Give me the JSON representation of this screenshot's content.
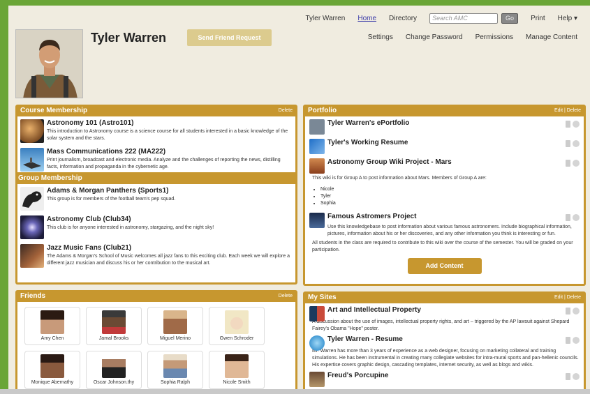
{
  "topnav": {
    "user": "Tyler Warren",
    "home": "Home",
    "directory": "Directory",
    "search_placeholder": "Search AMC",
    "go": "Go",
    "print": "Print",
    "help": "Help ▾"
  },
  "profile": {
    "name": "Tyler Warren",
    "send_friend_request": "Send Friend Request"
  },
  "subnav": {
    "settings": "Settings",
    "change_password": "Change Password",
    "permissions": "Permissions",
    "manage_content": "Manage Content"
  },
  "course_membership": {
    "title": "Course Membership",
    "delete": "Delete",
    "items": [
      {
        "title": "Astronomy 101 (Astro101)",
        "desc": "This introduction to Astronomy course is a science course for all students interested in a basic knowledge of the solar system and the stars."
      },
      {
        "title": "Mass Communications 222 (MA222)",
        "desc": "Print journalism, broadcast and electronic media. Analyze and the challenges of reporting the news, distilling facts, information and propaganda in the cybernetic age."
      }
    ]
  },
  "group_membership": {
    "title": "Group Membership",
    "items": [
      {
        "title": "Adams & Morgan Panthers (Sports1)",
        "desc": "This group is for members of the football team's pep squad."
      },
      {
        "title": "Astronomy Club (Club34)",
        "desc": "This club is for anyone interested in astronomy, stargazing, and the night sky!"
      },
      {
        "title": "Jazz Music Fans (Club21)",
        "desc": "The Adams & Morgan's School of Music welcomes all jazz fans to this exciting club. Each week we will explore a different jazz musician and discuss his or her contribution to the musical art."
      }
    ]
  },
  "friends": {
    "title": "Friends",
    "delete": "Delete",
    "people": [
      "Amy Chen",
      "Jamal Brooks",
      "Miguel Merino",
      "Gwen Schroder",
      "Monique Abernathy",
      "Oscar Johnson.thy",
      "Sophia Ralph",
      "Nicole Smith"
    ]
  },
  "portfolio": {
    "title": "Portfolio",
    "actions": "Edit | Delete",
    "items": [
      {
        "title": "Tyler Warren's ePortfolio"
      },
      {
        "title": "Tyler's Working Resume"
      },
      {
        "title": "Astronomy Group Wiki Project - Mars",
        "desc": "This wiki is for Group A to post information about Mars. Members of Group A are:"
      },
      {
        "title": "Famous Astromers Project",
        "desc": "Use this knowledgebase to post information about various famous astronomers. Include biographical information, pictures, information about his or her discoveries, and any other information you think is interesting or fun."
      }
    ],
    "members": [
      "Nicole",
      "Tyler",
      "Sophia"
    ],
    "note": "All students in the class are required to contribute to this wiki over the course of the semester. You will be graded on your participation.",
    "add_content": "Add Content"
  },
  "my_sites": {
    "title": "My Sites",
    "actions": "Edit | Delete",
    "items": [
      {
        "title": "Art and Intellectual Property",
        "desc": "A discussion about the use of images, intellectual property rights, and art – triggered by the AP lawsuit against Shepard Fairey's Obama \"Hope\" poster."
      },
      {
        "title": "Tyler Warren - Resume",
        "desc": "Mr. Warren has more than 3 years of experience as a web designer, focusing on marketing collateral and training simulations. He has been instrumental in creating many collegiate websites for intra-mural sports and pan-hellenic councils. His expertise covers graphic design, cascading templates, internet security, as well as blogs and wikis."
      },
      {
        "title": "Freud's Porcupine"
      }
    ]
  }
}
